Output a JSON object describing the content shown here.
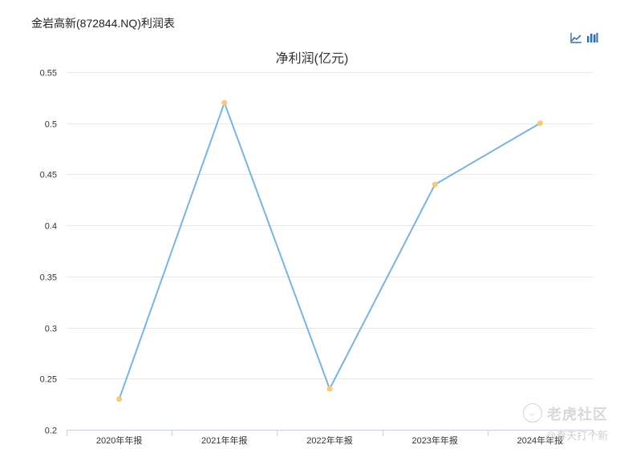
{
  "page": {
    "title": "金岩高新(872844.NQ)利润表"
  },
  "toolbar": {
    "line_icon": "line-chart-icon",
    "bar_icon": "bar-chart-icon"
  },
  "watermark": {
    "brand": "老虎社区",
    "user": "@春天打个新"
  },
  "chart_data": {
    "type": "line",
    "title": "净利润(亿元)",
    "categories": [
      "2020年年报",
      "2021年年报",
      "2022年年报",
      "2023年年报",
      "2024年年报"
    ],
    "series": [
      {
        "values": [
          0.23,
          0.52,
          0.24,
          0.44,
          0.5
        ]
      }
    ],
    "ylim": [
      0.2,
      0.55
    ],
    "yticks": [
      "0.2",
      "0.25",
      "0.3",
      "0.35",
      "0.4",
      "0.45",
      "0.5",
      "0.55"
    ],
    "grid": true,
    "colors": {
      "line": "#7ab3de",
      "point": "#f8c77a",
      "grid": "#e6e6e6",
      "axis": "#c6d0e4"
    }
  }
}
